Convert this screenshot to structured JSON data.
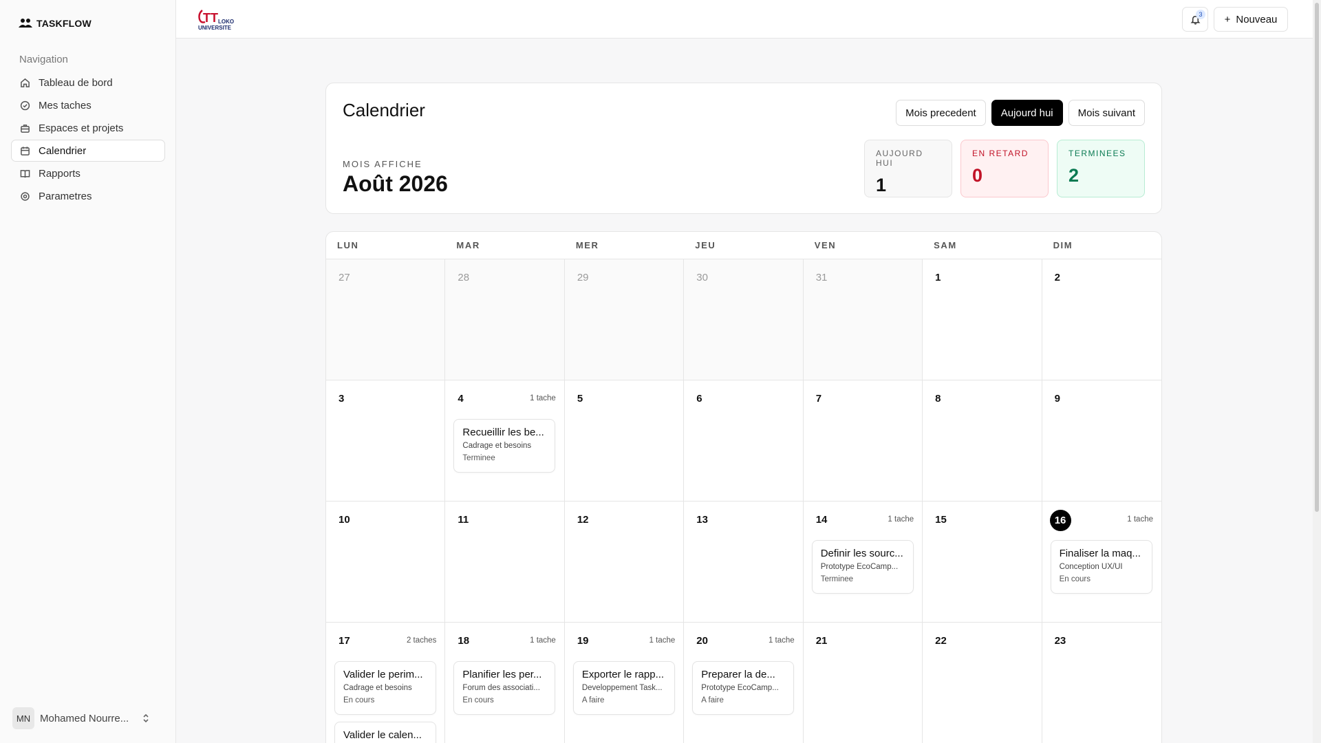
{
  "brand": {
    "name": "TASKFLOW"
  },
  "sidebar": {
    "title": "Navigation",
    "items": [
      {
        "label": "Tableau de bord",
        "icon": "home-icon",
        "active": false
      },
      {
        "label": "Mes taches",
        "icon": "check-circle-icon",
        "active": false
      },
      {
        "label": "Espaces et projets",
        "icon": "briefcase-icon",
        "active": false
      },
      {
        "label": "Calendrier",
        "icon": "calendar-icon",
        "active": true
      },
      {
        "label": "Rapports",
        "icon": "book-icon",
        "active": false
      },
      {
        "label": "Parametres",
        "icon": "settings-icon",
        "active": false
      }
    ],
    "user": {
      "initials": "MN",
      "name": "Mohamed Nourre..."
    }
  },
  "topbar": {
    "logo_text": "LOKO UNIVERSITE",
    "notifications_count": "3",
    "new_label": "Nouveau"
  },
  "header": {
    "title": "Calendrier",
    "prev_label": "Mois precedent",
    "today_label": "Aujourd hui",
    "next_label": "Mois suivant",
    "month_label": "MOIS AFFICHE",
    "month_value": "Août 2026",
    "stats": [
      {
        "label": "AUJOURD HUI",
        "value": "1",
        "kind": "today"
      },
      {
        "label": "EN RETARD",
        "value": "0",
        "kind": "late"
      },
      {
        "label": "TERMINEES",
        "value": "2",
        "kind": "done"
      }
    ]
  },
  "calendar": {
    "weekdays": [
      "LUN",
      "MAR",
      "MER",
      "JEU",
      "VEN",
      "SAM",
      "DIM"
    ],
    "days": [
      {
        "num": "27",
        "other": true
      },
      {
        "num": "28",
        "other": true
      },
      {
        "num": "29",
        "other": true
      },
      {
        "num": "30",
        "other": true
      },
      {
        "num": "31",
        "other": true
      },
      {
        "num": "1"
      },
      {
        "num": "2"
      },
      {
        "num": "3"
      },
      {
        "num": "4",
        "count": "1 tache",
        "tasks": [
          {
            "title": "Recueillir les be...",
            "project": "Cadrage et besoins",
            "status": "Terminee"
          }
        ]
      },
      {
        "num": "5"
      },
      {
        "num": "6"
      },
      {
        "num": "7"
      },
      {
        "num": "8"
      },
      {
        "num": "9"
      },
      {
        "num": "10"
      },
      {
        "num": "11"
      },
      {
        "num": "12"
      },
      {
        "num": "13"
      },
      {
        "num": "14",
        "count": "1 tache",
        "tasks": [
          {
            "title": "Definir les sourc...",
            "project": "Prototype EcoCamp...",
            "status": "Terminee"
          }
        ]
      },
      {
        "num": "15"
      },
      {
        "num": "16",
        "today": true,
        "count": "1 tache",
        "tasks": [
          {
            "title": "Finaliser la maq...",
            "project": "Conception UX/UI",
            "status": "En cours"
          }
        ]
      },
      {
        "num": "17",
        "count": "2 taches",
        "tasks": [
          {
            "title": "Valider le perim...",
            "project": "Cadrage et besoins",
            "status": "En cours"
          },
          {
            "title": "Valider le calen...",
            "project": "",
            "status": ""
          }
        ]
      },
      {
        "num": "18",
        "count": "1 tache",
        "tasks": [
          {
            "title": "Planifier les per...",
            "project": "Forum des associati...",
            "status": "En cours"
          }
        ]
      },
      {
        "num": "19",
        "count": "1 tache",
        "tasks": [
          {
            "title": "Exporter le rapp...",
            "project": "Developpement Task...",
            "status": "A faire"
          }
        ]
      },
      {
        "num": "20",
        "count": "1 tache",
        "tasks": [
          {
            "title": "Preparer la de...",
            "project": "Prototype EcoCamp...",
            "status": "A faire"
          }
        ]
      },
      {
        "num": "21"
      },
      {
        "num": "22"
      },
      {
        "num": "23"
      }
    ]
  }
}
